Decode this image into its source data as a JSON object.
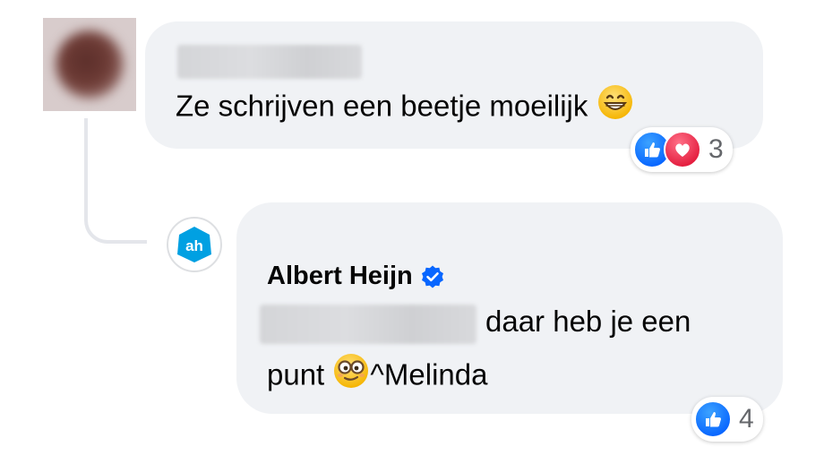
{
  "comment": {
    "author_redacted": true,
    "text": "Ze schrijven een beetje moeilijk",
    "emoji_icon": "grinning-face-icon",
    "reactions": {
      "icons": [
        "like-icon",
        "love-icon"
      ],
      "count": "3"
    }
  },
  "reply": {
    "author": "Albert Heijn",
    "verified_icon": "verified-badge-icon",
    "mention_redacted": true,
    "text_line_1": "daar heb je een",
    "text_line_2_before": "punt",
    "emoji_icon": "nerd-glasses-face-icon",
    "text_line_2_after": "^Melinda",
    "reactions": {
      "icons": [
        "like-icon"
      ],
      "count": "4"
    }
  },
  "colors": {
    "bubble": "#f0f2f5",
    "like": "#0866ff",
    "love": "#e41e3f",
    "verified": "#0866ff",
    "ah_brand": "#00a0e2"
  }
}
